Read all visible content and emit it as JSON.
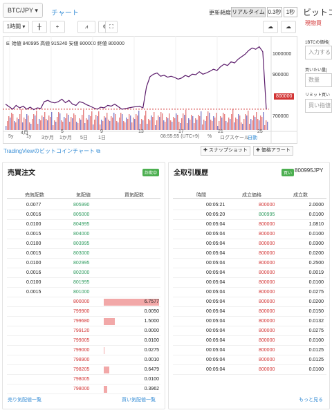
{
  "top": {
    "pair": "BTC/JPY",
    "chart_tab": "チャート",
    "update_freq_label": "更新頻度",
    "freq_options": [
      "リアルタイム",
      "0.3秒",
      "1秒"
    ],
    "right_title": "ビットコ"
  },
  "right_panel": {
    "sub": "現物買",
    "l1": "1BTCの価格(",
    "ph1": "入力する",
    "l2": "買いたい量(",
    "ph2": "数量",
    "l3": "リミット買い",
    "ph3": "買い指値"
  },
  "toolbar": {
    "interval": "1時間"
  },
  "chart": {
    "ohlc": "始値 840995 高値 915240 安値 800000 終値 800000",
    "y_ticks": [
      "1000000",
      "900000",
      "800000",
      "700000"
    ],
    "current_price": "800000",
    "x_labels": [
      "4月",
      "5",
      "9",
      "13",
      "17",
      "21",
      "25"
    ],
    "ranges": [
      "5y",
      "1y",
      "3か月",
      "1か月",
      "5日",
      "1日"
    ],
    "clock": "08:55:55 (UTC+9)",
    "pct": "%",
    "log": "ログスケール",
    "auto": "自動"
  },
  "chart_data": {
    "type": "line",
    "xlabel": "",
    "ylabel": "",
    "y_ticks": [
      1000000,
      900000,
      800000,
      700000
    ],
    "ylim": [
      650000,
      1060000
    ],
    "x_tick_labels": [
      "4月",
      "5",
      "9",
      "13",
      "17",
      "21",
      "25"
    ],
    "close": [
      820000,
      810000,
      800000,
      815000,
      805000,
      812000,
      800000,
      808000,
      798000,
      805000,
      803000,
      830000,
      835000,
      828000,
      825000,
      830000,
      840000,
      826000,
      835000,
      820000,
      815000,
      830000,
      826000,
      818000,
      812000,
      805000,
      800000,
      808000,
      805000,
      815000,
      812000,
      820000,
      810000,
      800000,
      802000,
      805000,
      808000,
      810000,
      812000,
      805000,
      890000,
      930000,
      940000,
      945000,
      932000,
      936000,
      928000,
      932000,
      927000,
      920000,
      925000,
      935000,
      930000,
      940000,
      938000,
      950000,
      940000,
      945000,
      952000,
      960000,
      955000,
      970000,
      980000,
      975000,
      990000,
      985000,
      1000000,
      1010000,
      1020000,
      1035000,
      1045000,
      1040000,
      1050000,
      1030000,
      800000
    ],
    "last_price": 800000,
    "reference_line": 800000
  },
  "links": {
    "tv": "TradingViewのビットコインチャート",
    "snap": "スナップショット",
    "alert": "価格アラート"
  },
  "orderbook": {
    "title": "売買注文",
    "badge": "詐欺中",
    "cols": [
      "売気配数",
      "気配値",
      "買気配数"
    ],
    "asks": [
      [
        "0.0077",
        "805990"
      ],
      [
        "0.0016",
        "805000"
      ],
      [
        "0.0100",
        "804995"
      ],
      [
        "0.0015",
        "804000"
      ],
      [
        "0.0100",
        "803995"
      ],
      [
        "0.0015",
        "803000"
      ],
      [
        "0.0100",
        "802995"
      ],
      [
        "0.0016",
        "802000"
      ],
      [
        "0.0100",
        "801995"
      ],
      [
        "0.0015",
        "801000"
      ]
    ],
    "bids": [
      [
        "800000",
        "6.7577"
      ],
      [
        "799900",
        "0.0050"
      ],
      [
        "799680",
        "1.5000"
      ],
      [
        "799120",
        "0.0000"
      ],
      [
        "799005",
        "0.0100"
      ],
      [
        "799000",
        "0.0275"
      ],
      [
        "798900",
        "0.0010"
      ],
      [
        "798205",
        "0.6479"
      ],
      [
        "798005",
        "0.0100"
      ],
      [
        "798000",
        "0.3962"
      ]
    ],
    "bid_fill": [
      1.0,
      0.0,
      0.2,
      0.0,
      0.0,
      0.01,
      0.0,
      0.1,
      0.0,
      0.06
    ],
    "foot_left": "売り気配値一覧",
    "foot_right": "買い気配値一覧"
  },
  "trades": {
    "title": "全取引履歴",
    "badge": "買い",
    "last": "800995JPY",
    "cols": [
      "時間",
      "成立価格",
      "成立数"
    ],
    "rows": [
      [
        "00:05:21",
        "800000",
        "2.0000"
      ],
      [
        "00:05:20",
        "800995",
        "0.0100"
      ],
      [
        "00:05:04",
        "800000",
        "1.0810"
      ],
      [
        "00:05:04",
        "800000",
        "0.0100"
      ],
      [
        "00:05:04",
        "800000",
        "0.0300"
      ],
      [
        "00:05:04",
        "800000",
        "0.0200"
      ],
      [
        "00:05:04",
        "800000",
        "0.2500"
      ],
      [
        "00:05:04",
        "800000",
        "0.0019"
      ],
      [
        "00:05:04",
        "800000",
        "0.0100"
      ],
      [
        "00:05:04",
        "800000",
        "0.0275"
      ],
      [
        "00:05:04",
        "800000",
        "0.0200"
      ],
      [
        "00:05:04",
        "800000",
        "0.0150"
      ],
      [
        "00:05:04",
        "800000",
        "0.0132"
      ],
      [
        "00:05:04",
        "800000",
        "0.0275"
      ],
      [
        "00:05:04",
        "800000",
        "0.0100"
      ],
      [
        "00:05:04",
        "800000",
        "0.0125"
      ],
      [
        "00:05:04",
        "800000",
        "0.0125"
      ],
      [
        "00:05:04",
        "800000",
        "0.0100"
      ]
    ],
    "row_colors": [
      "r",
      "g",
      "r",
      "r",
      "r",
      "r",
      "r",
      "r",
      "r",
      "r",
      "r",
      "r",
      "r",
      "r",
      "r",
      "r",
      "r",
      "r"
    ],
    "more": "もっと見る"
  },
  "colors": {
    "accent": "#3a8fd6",
    "up": "#2e9b5e",
    "down": "#d23333",
    "price_line": "#5a1a6a"
  }
}
